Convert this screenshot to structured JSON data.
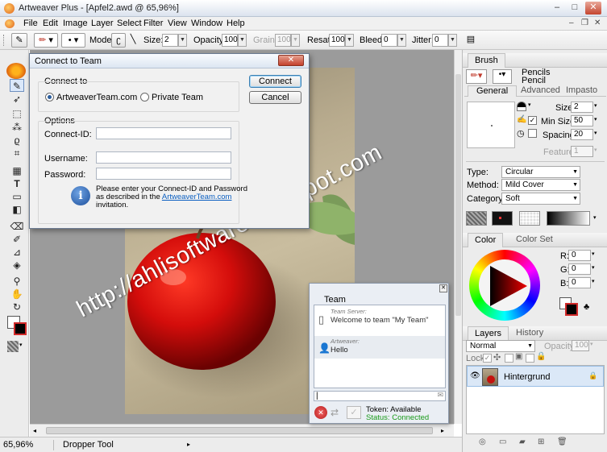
{
  "window": {
    "title": "Artweaver Plus - [Apfel2.awd @ 65,96%]",
    "minimize": "–",
    "maximize": "□",
    "close": "✕"
  },
  "menu": {
    "items": [
      "File",
      "Edit",
      "Image",
      "Layer",
      "Select",
      "Filter",
      "View",
      "Window",
      "Help"
    ],
    "mdi_min": "–",
    "mdi_restore": "❐",
    "mdi_close": "✕"
  },
  "options": {
    "mode_label": "Mode:",
    "size_label": "Size:",
    "size_value": "2",
    "opacity_label": "Opacity:",
    "opacity_value": "100",
    "grain_label": "Grain:",
    "grain_value": "100",
    "resat_label": "Resat:",
    "resat_value": "100",
    "bleed_label": "Bleed:",
    "bleed_value": "0",
    "jitter_label": "Jitter:",
    "jitter_value": "0"
  },
  "status": {
    "zoom": "65,96%",
    "tool": "Dropper Tool"
  },
  "dialog": {
    "title": "Connect to Team",
    "connect_to_label": "Connect to",
    "radio_artweaver": "ArtweaverTeam.com",
    "radio_private": "Private Team",
    "options_label": "Options",
    "connect_id_label": "Connect-ID:",
    "username_label": "Username:",
    "password_label": "Password:",
    "info_line1": "Please enter your Connect-ID and Password",
    "info_line2_prefix": "as described in the ",
    "info_link": "ArtweaverTeam.com",
    "info_line3": "invitation.",
    "connect_button": "Connect",
    "cancel_button": "Cancel"
  },
  "team": {
    "title": "Team",
    "msg1_sender": "Team Server:",
    "msg1_text": "Welcome to team \"My Team\"",
    "msg2_sender": "Artweaver:",
    "msg2_text": "Hello",
    "token_label": "Token: Available",
    "status_label": "Status: Connected"
  },
  "brush_panel": {
    "title": "Brush",
    "category": "Pencils",
    "variant": "Pencil",
    "tabs": [
      "General",
      "Advanced",
      "Impasto"
    ],
    "size_label": "Size:",
    "size_value": "2",
    "min_size_label": "Min Size:",
    "min_size_value": "50",
    "spacing_label": "Spacing:",
    "spacing_value": "20",
    "feature_label": "Feature:",
    "feature_value": "1",
    "type_label": "Type:",
    "type_value": "Circular",
    "method_label": "Method:",
    "method_value": "Mild Cover",
    "category_label": "Category:",
    "category_value": "Soft"
  },
  "color_panel": {
    "tabs": [
      "Color",
      "Color Set"
    ],
    "r_label": "R:",
    "r_value": "0",
    "g_label": "G:",
    "g_value": "0",
    "b_label": "B:",
    "b_value": "0"
  },
  "layers_panel": {
    "tabs": [
      "Layers",
      "History"
    ],
    "blend_mode": "Normal",
    "opacity_label": "Opacity:",
    "opacity_value": "100",
    "lock_label": "Lock:",
    "layer_name": "Hintergrund"
  },
  "watermark": "http://ahlisoftware.blogspot.com"
}
